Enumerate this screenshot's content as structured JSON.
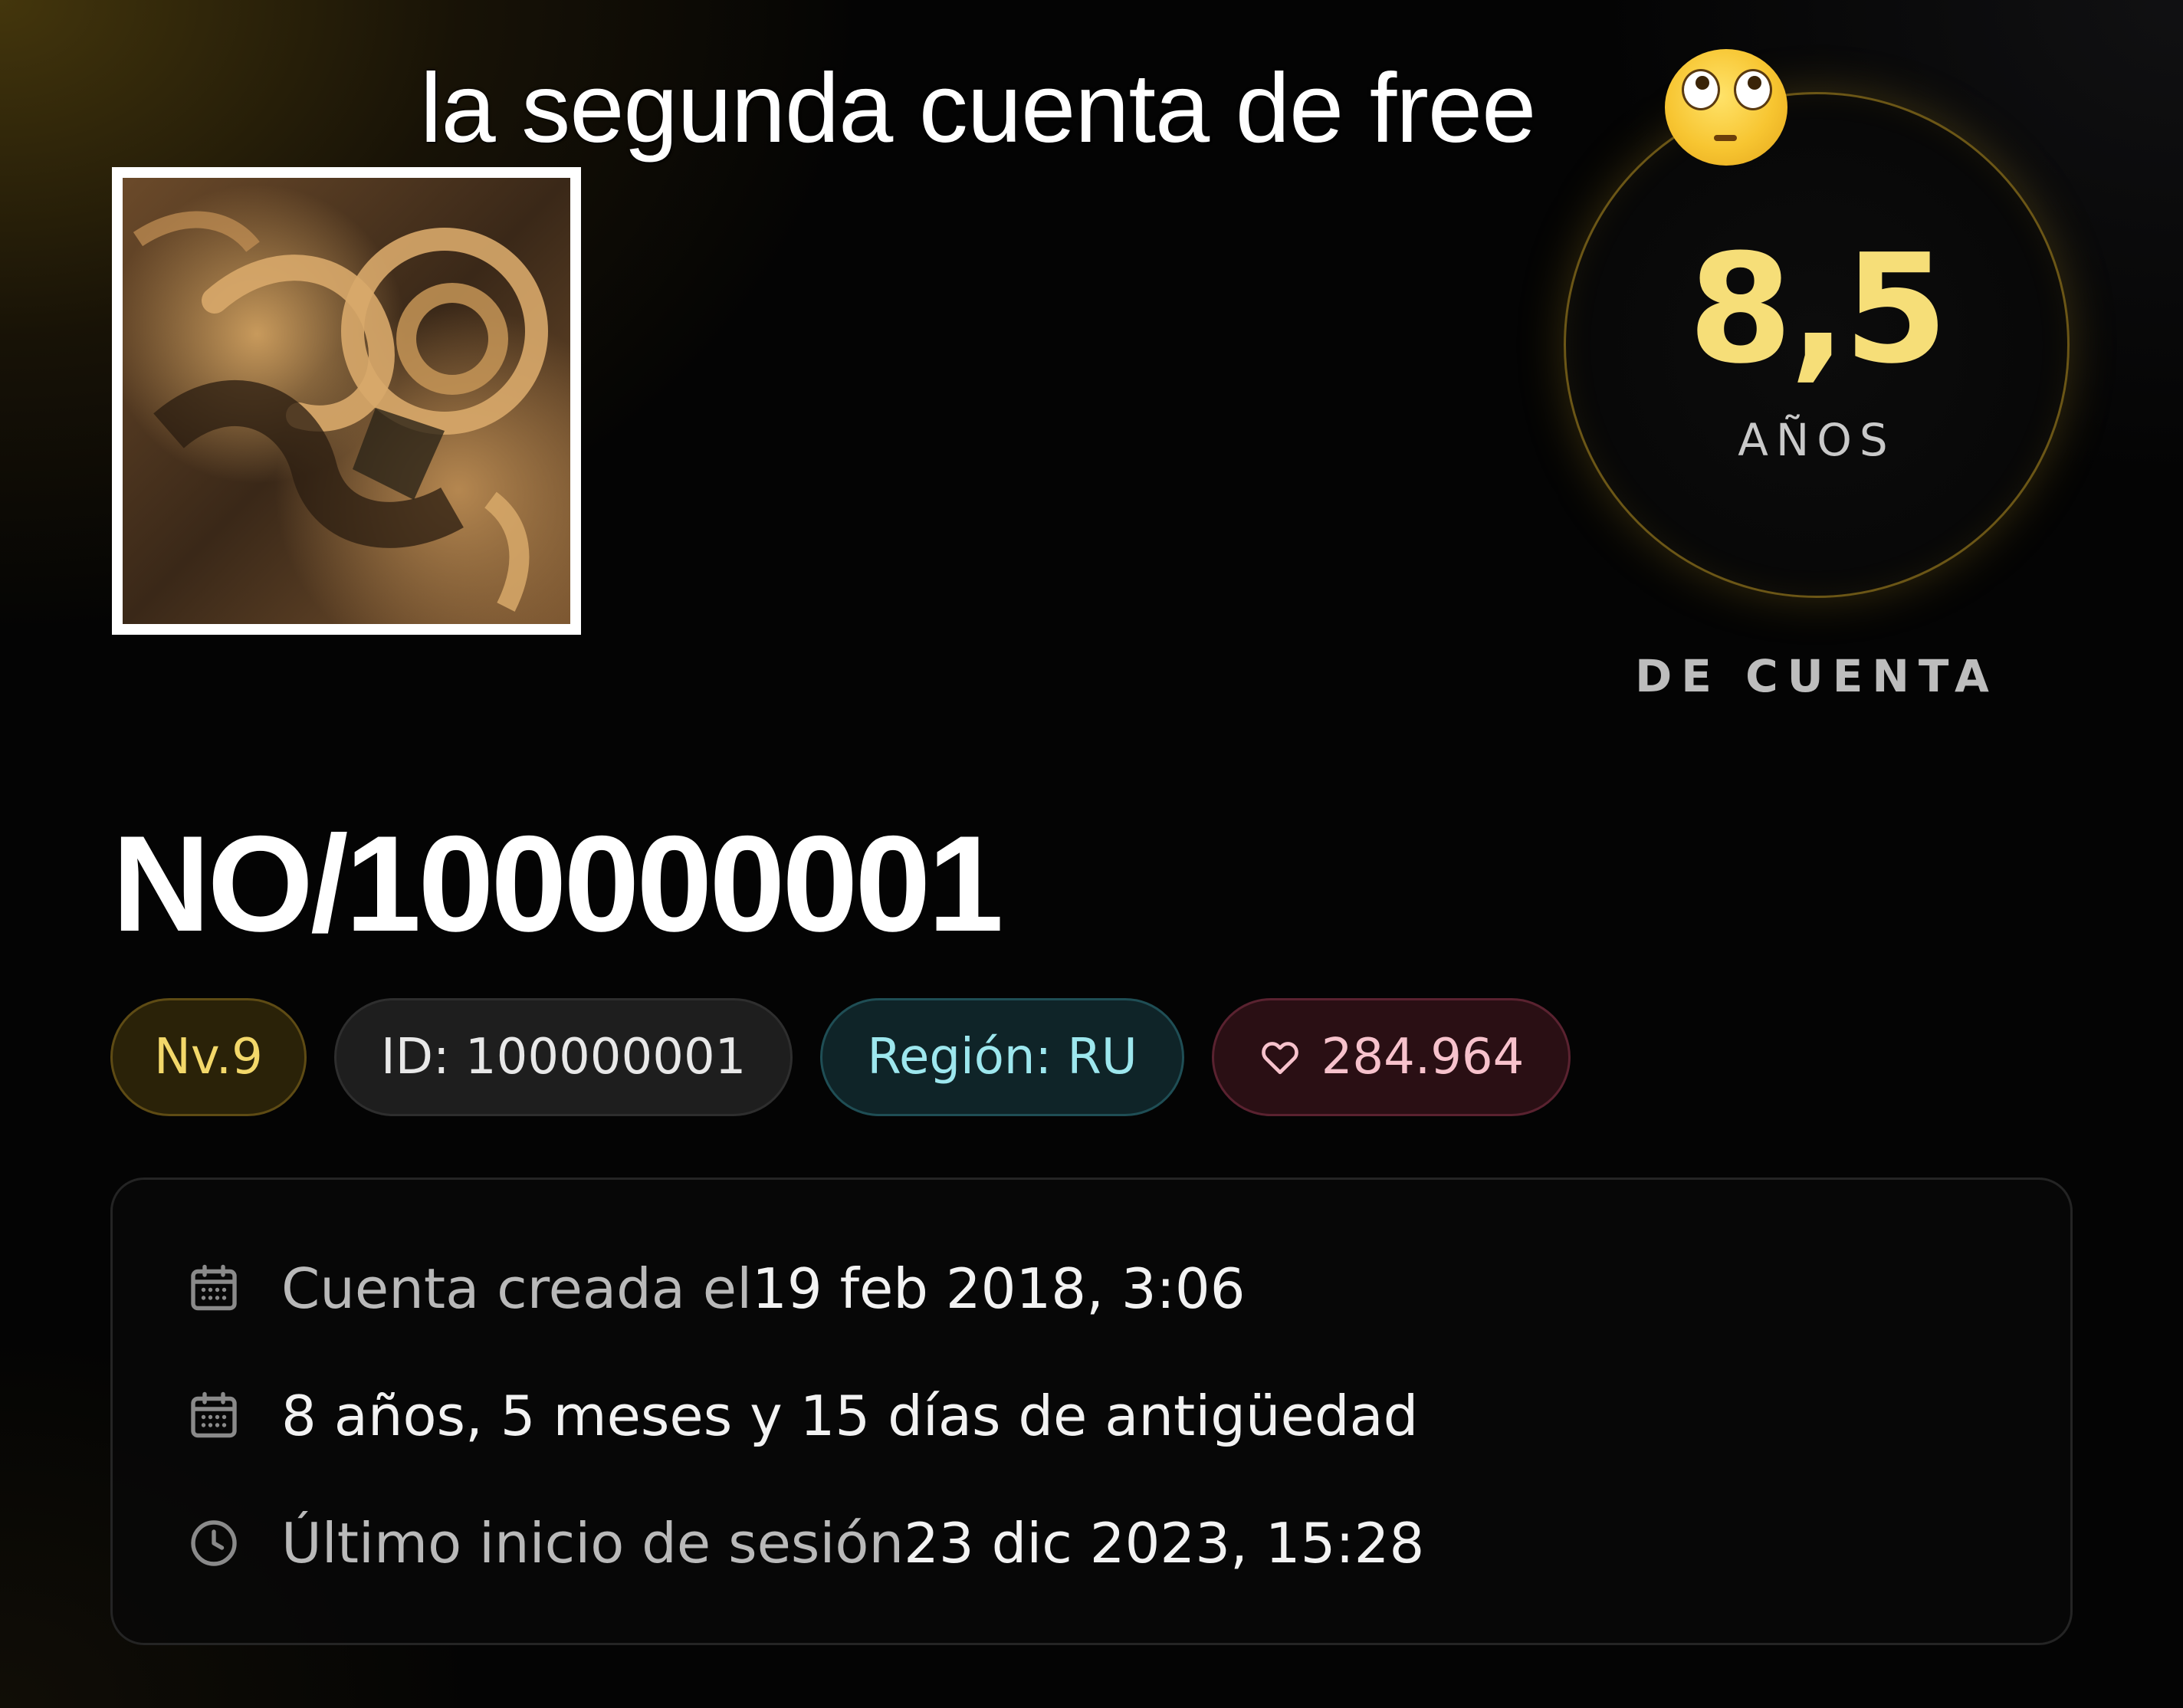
{
  "caption": {
    "text": "la segunda cuenta de free",
    "emoji": "flushed-face-emoji"
  },
  "profile": {
    "avatar_icon": "profile-avatar-image",
    "username": "NO/100000001"
  },
  "account_age": {
    "value": "8,5",
    "unit": "AÑOS",
    "subtitle": "DE CUENTA",
    "accent_color": "#f6de78"
  },
  "badges": {
    "level": "Nv.9",
    "id": "ID: 100000001",
    "region": "Región: RU",
    "likes": "284.964",
    "likes_icon": "heart-icon"
  },
  "info": {
    "created_label": "Cuenta creada el ",
    "created_value": "19 feb 2018, 3:06",
    "age_value": "8 años, 5 meses y 15 días de antigüedad",
    "last_login_label": "Último inicio de sesión ",
    "last_login_value": "23 dic 2023, 15:28",
    "icons": [
      "calendar-icon",
      "calendar-icon",
      "clock-icon"
    ]
  },
  "colors": {
    "level": "#f3d86a",
    "region": "#9de7ee",
    "likes": "#f7c2cc"
  }
}
